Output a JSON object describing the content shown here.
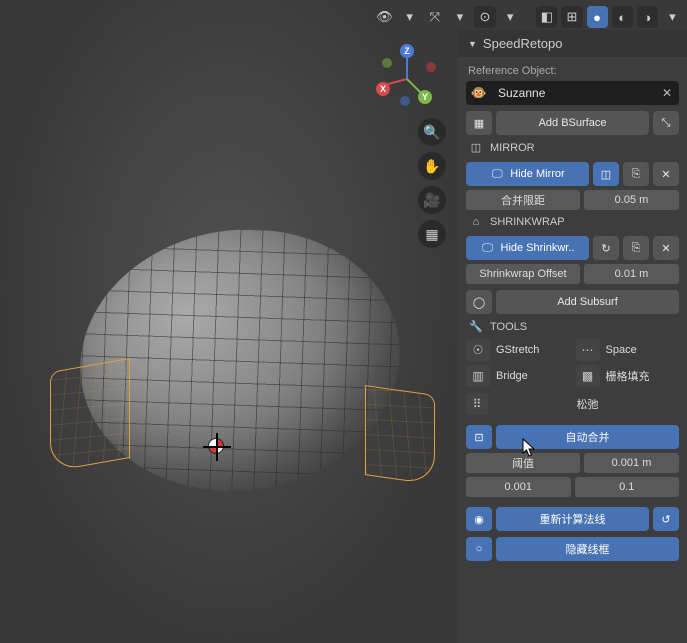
{
  "panel": {
    "title": "SpeedRetopo",
    "reference_label": "Reference Object:",
    "reference_value": "Suzanne",
    "add_bsurface": "Add BSurface"
  },
  "mirror": {
    "heading": "MIRROR",
    "hide": "Hide Mirror",
    "merge_label": "合并限距",
    "merge_value": "0.05 m"
  },
  "shrinkwrap": {
    "heading": "SHRINKWRAP",
    "hide": "Hide Shrinkwr..",
    "offset_label": "Shrinkwrap Offset",
    "offset_value": "0.01 m",
    "add_subsurf": "Add Subsurf"
  },
  "tools": {
    "heading": "TOOLS",
    "gstretch": "GStretch",
    "space": "Space",
    "bridge": "Bridge",
    "gridfill": "栅格填充",
    "relax": "松弛"
  },
  "automerge": {
    "label": "自动合并",
    "threshold_label": "阈值",
    "threshold_value": "0.001 m",
    "min": "0.001",
    "max": "0.1"
  },
  "normals": {
    "recalc": "重新计算法线",
    "hide": "隐藏线框"
  },
  "gizmo": {
    "x": "X",
    "y": "Y",
    "z": "Z"
  }
}
